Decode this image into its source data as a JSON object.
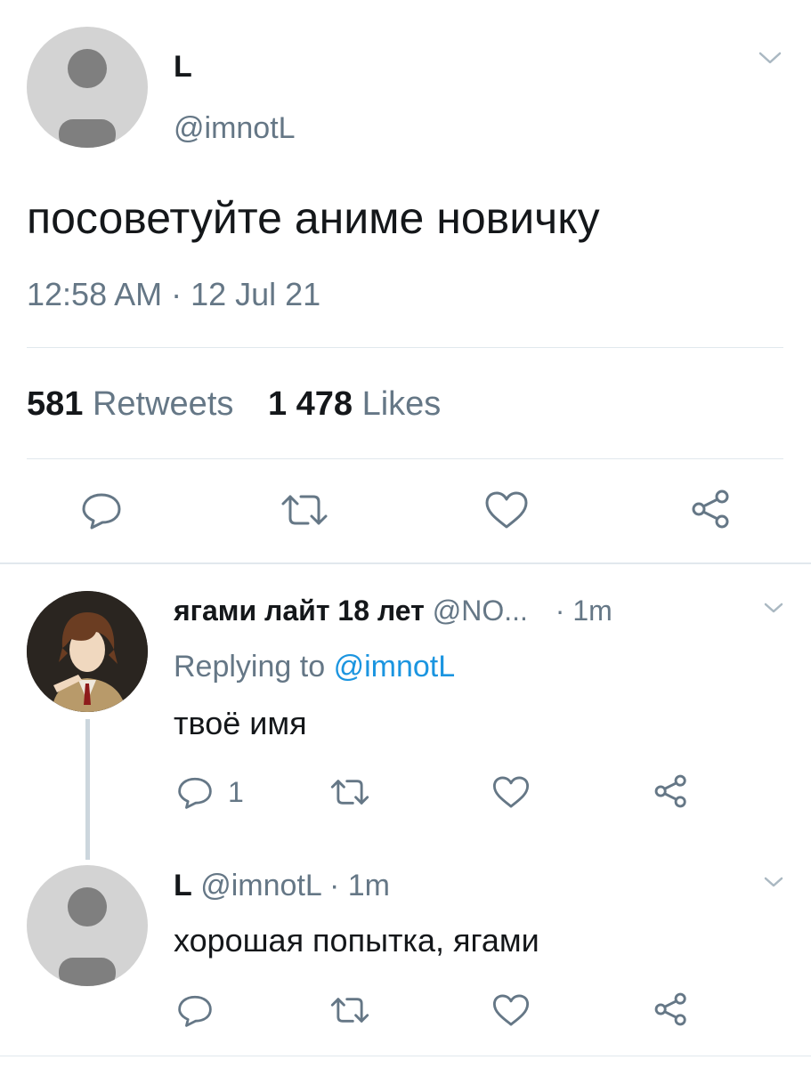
{
  "main_tweet": {
    "display_name": "L",
    "handle": "@imnotL",
    "text": "посоветуйте аниме новичку",
    "timestamp": "12:58 AM · 12 Jul 21",
    "retweets_count": "581",
    "retweets_label": "Retweets",
    "likes_count": "1 478",
    "likes_label": "Likes"
  },
  "reply_1": {
    "display_name": "ягами лайт 18 лет",
    "handle": "@NO...",
    "time": "· 1m",
    "replying_prefix": "Replying to",
    "replying_handle": "@imnotL",
    "text": "твоё имя",
    "reply_count": "1"
  },
  "reply_2": {
    "display_name": "L",
    "handle_time": "@imnotL · 1m",
    "text": "хорошая попытка, ягами"
  },
  "icons": [
    "chevron-down-icon",
    "reply-icon",
    "retweet-icon",
    "like-icon",
    "share-icon"
  ],
  "colors": {
    "text": "#14171a",
    "secondary": "#657786",
    "link": "#1b95e0",
    "divider": "#e1e8ed",
    "avatar_bg": "#d3d3d3",
    "avatar_fg": "#7f7f7f"
  }
}
